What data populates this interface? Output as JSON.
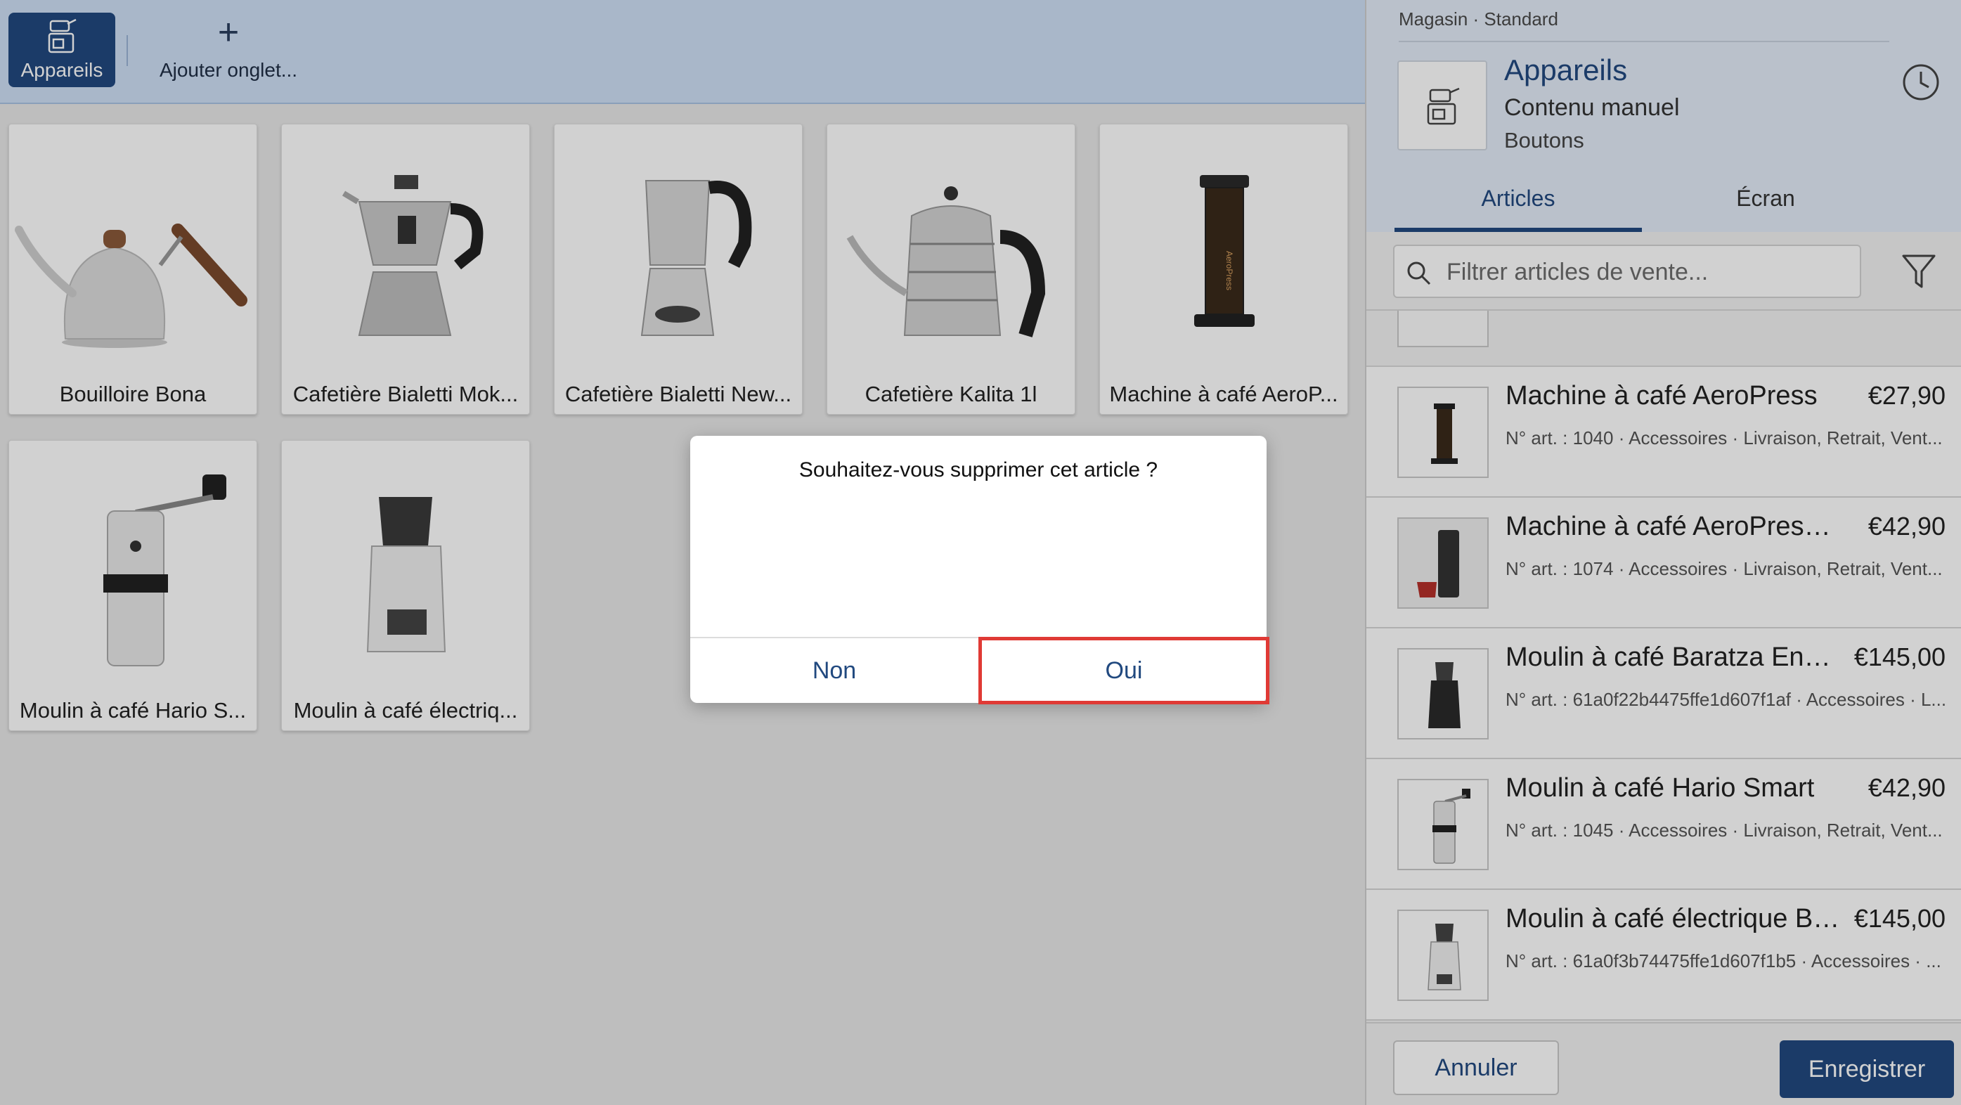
{
  "tabs": {
    "active_label": "Appareils",
    "add_label": "Ajouter onglet..."
  },
  "grid": {
    "items": [
      {
        "name": "Bouilloire Bona",
        "icon": "kettle-image"
      },
      {
        "name": "Cafetière Bialetti Mok...",
        "icon": "moka-pot-image"
      },
      {
        "name": "Cafetière Bialetti New...",
        "icon": "moka-pot-steel-image"
      },
      {
        "name": "Cafetière Kalita 1l",
        "icon": "kettle-steel-image"
      },
      {
        "name": "Machine à café AeroP...",
        "icon": "aeropress-image"
      },
      {
        "name": "Moulin à café Hario S...",
        "icon": "hand-grinder-image"
      },
      {
        "name": "Moulin à café électriq...",
        "icon": "electric-grinder-image"
      }
    ]
  },
  "panel": {
    "breadcrumb": "Magasin · Standard",
    "title": "Appareils",
    "subtitle1": "Contenu manuel",
    "subtitle2": "Boutons",
    "segment_articles": "Articles",
    "segment_screen": "Écran",
    "search_placeholder": "Filtrer articles de vente...",
    "rows": [
      {
        "name": "Machine à café AeroPress",
        "price": "€27,90",
        "meta": "N° art. : 1040 · Accessoires · Livraison, Retrait, Vent..."
      },
      {
        "name": "Machine à café AeroPress Go",
        "price": "€42,90",
        "meta": "N° art. : 1074 · Accessoires · Livraison, Retrait, Vent..."
      },
      {
        "name": "Moulin à café Baratza Encor...",
        "price": "€145,00",
        "meta": "N° art. : 61a0f22b4475ffe1d607f1af · Accessoires · L..."
      },
      {
        "name": "Moulin à café Hario Smart",
        "price": "€42,90",
        "meta": "N° art. : 1045 · Accessoires · Livraison, Retrait, Vent..."
      },
      {
        "name": "Moulin à café électrique Bar...",
        "price": "€145,00",
        "meta": "N° art. : 61a0f3b74475ffe1d607f1b5 · Accessoires · ..."
      }
    ],
    "cancel_label": "Annuler",
    "save_label": "Enregistrer"
  },
  "dialog": {
    "message": "Souhaitez-vous supprimer cet article ?",
    "no_label": "Non",
    "yes_label": "Oui"
  },
  "colors": {
    "primary": "#21497f",
    "highlight": "#e03a35"
  }
}
